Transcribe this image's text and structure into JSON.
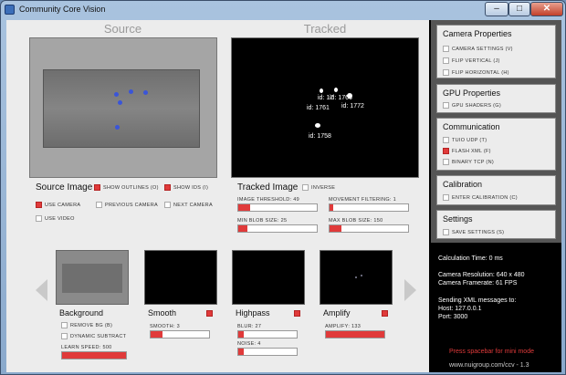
{
  "window": {
    "title": "Community Core Vision"
  },
  "source": {
    "header": "Source",
    "section_label": "Source Image",
    "show_outlines": "SHOW OUTLINES (O)",
    "show_ids": "SHOW IDS (I)",
    "use_camera": "USE CAMERA",
    "previous_camera": "PREVIOUS CAMERA",
    "next_camera": "NEXT CAMERA",
    "use_video": "USE VIDEO"
  },
  "tracked": {
    "header": "Tracked",
    "section_label": "Tracked Image",
    "inverse": "INVERSE",
    "image_threshold": "IMAGE THRESHOLD: 49",
    "image_threshold_value": 0.15,
    "movement_filtering": "MOVEMENT FILTERING: 1",
    "movement_filtering_value": 0.05,
    "min_blob": "MIN BLOB SIZE: 25",
    "min_blob_value": 0.12,
    "max_blob": "MAX BLOB SIZE: 150",
    "max_blob_value": 0.15,
    "ids": [
      "id: 1766",
      "id: 1761",
      "id: 1772",
      "id: 1758",
      "id: 17"
    ]
  },
  "camera_props": {
    "title": "Camera Properties",
    "items": [
      "CAMERA SETTINGS (V)",
      "FLIP VERTICAL (J)",
      "FLIP HORIZONTAL (H)"
    ]
  },
  "gpu_props": {
    "title": "GPU Properties",
    "items": [
      "GPU SHADERS (G)"
    ]
  },
  "communication": {
    "title": "Communication",
    "items": [
      "TUIO UDP (T)",
      "FLASH XML (F)",
      "BINARY TCP (N)"
    ]
  },
  "calibration": {
    "title": "Calibration",
    "items": [
      "ENTER CALIBRATION (C)"
    ]
  },
  "settings": {
    "title": "Settings",
    "items": [
      "SAVE SETTINGS (S)"
    ]
  },
  "filters": {
    "background": {
      "title": "Background",
      "remove_bg": "REMOVE BG (B)",
      "dynamic_subtract": "DYNAMIC SUBTRACT",
      "learn_speed": "LEARN SPEED: 500",
      "learn_speed_value": 1.0
    },
    "smooth": {
      "title": "Smooth",
      "smooth": "SMOOTH: 3",
      "smooth_value": 0.2
    },
    "highpass": {
      "title": "Highpass",
      "blur": "BLUR: 27",
      "blur_value": 0.1,
      "noise": "NOISE: 4",
      "noise_value": 0.1
    },
    "amplify": {
      "title": "Amplify",
      "amplify": "AMPLIFY: 133",
      "amplify_value": 1.0
    }
  },
  "info": {
    "calc_time": "Calculation Time:  0  ms",
    "cam_res": "Camera Resolution:  640 x 480",
    "cam_fps": "Camera Framerate:  61  FPS",
    "sending": "Sending XML messages to:",
    "host": "Host: 127.0.0.1",
    "port": "Port: 3000",
    "spacebar": "Press spacebar for mini mode",
    "url": "www.nuigroup.com/ccv - 1.3"
  },
  "colors": {
    "accent": "#e03a3a",
    "panel": "#ececec",
    "side": "#555555"
  }
}
